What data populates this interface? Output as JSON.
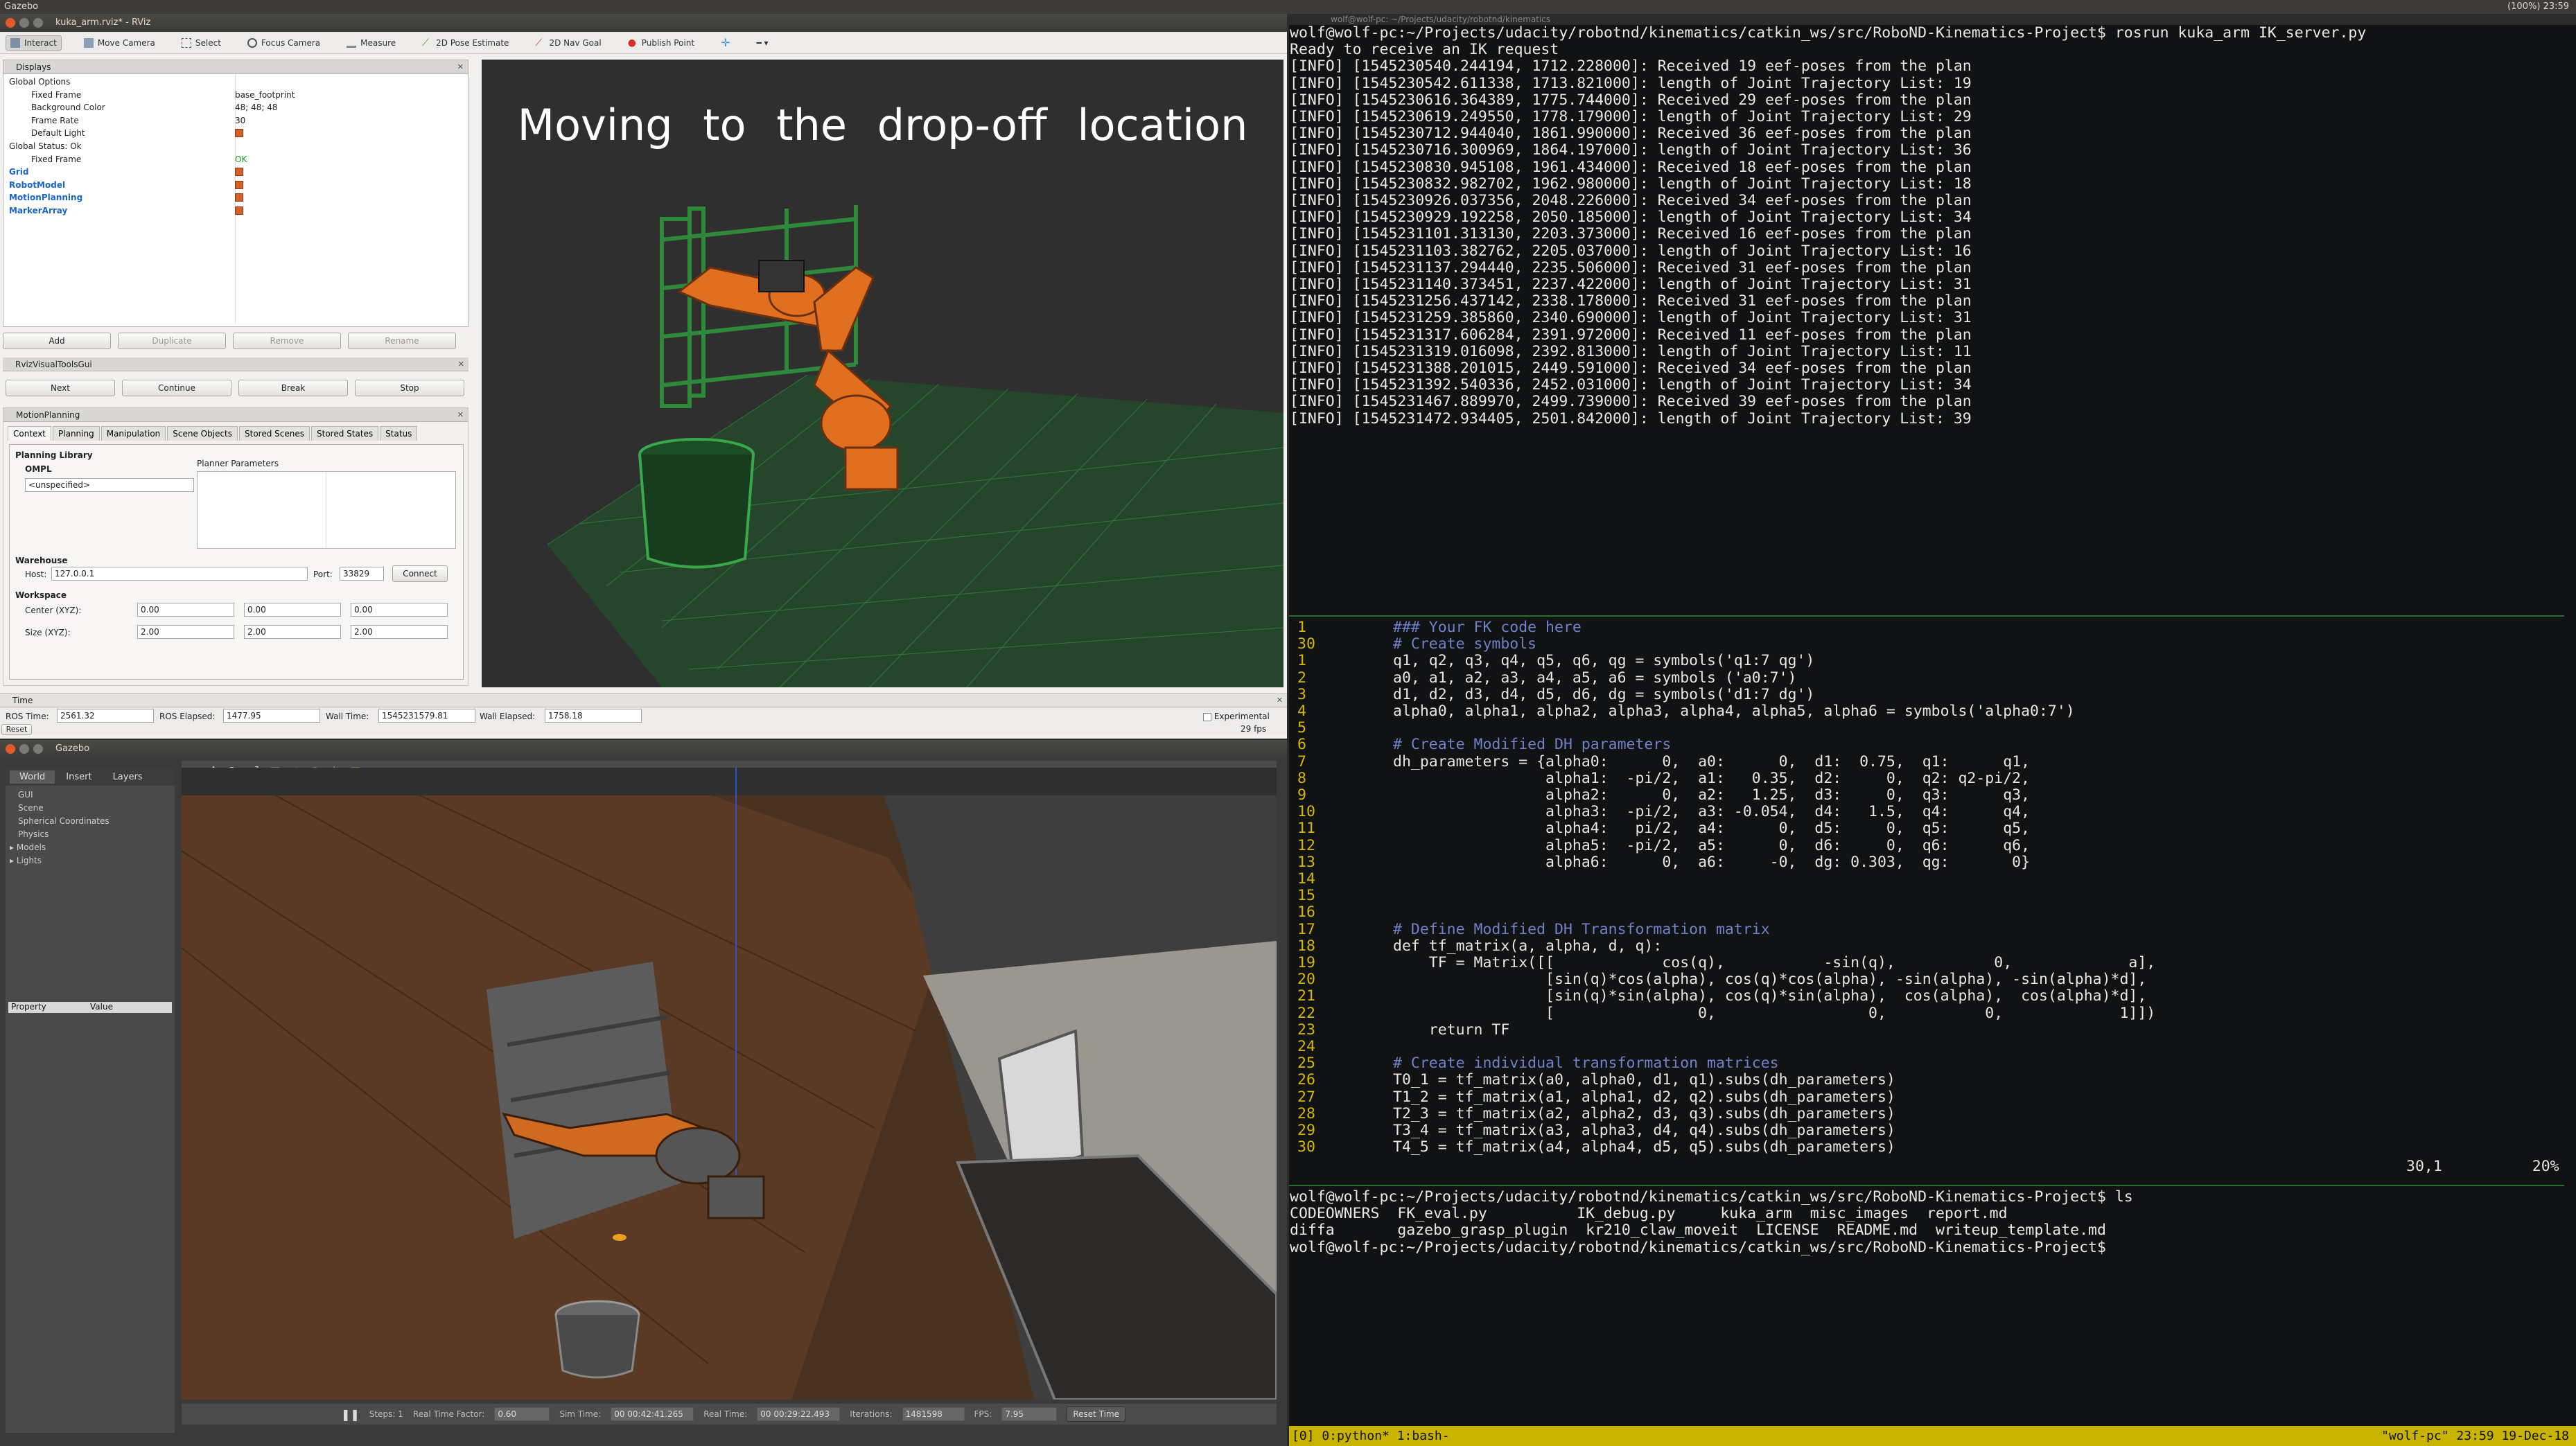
{
  "topbar": {
    "app": "Gazebo",
    "tray": "(100%)  23:59"
  },
  "rviz": {
    "title": "kuka_arm.rviz* - RViz",
    "toolbar": [
      "Interact",
      "Move Camera",
      "Select",
      "Focus Camera",
      "Measure",
      "2D Pose Estimate",
      "2D Nav Goal",
      "Publish Point"
    ],
    "displays": {
      "header": "Displays",
      "rows": [
        {
          "k": "Global Options",
          "v": "",
          "indent": 1
        },
        {
          "k": "Fixed Frame",
          "v": "base_footprint",
          "indent": 2
        },
        {
          "k": "Background Color",
          "v": "48; 48; 48",
          "indent": 2
        },
        {
          "k": "Frame Rate",
          "v": "30",
          "indent": 2
        },
        {
          "k": "Default Light",
          "v": "",
          "indent": 2
        },
        {
          "k": "Global Status: Ok",
          "v": "",
          "indent": 1
        },
        {
          "k": "Fixed Frame",
          "v": "OK",
          "indent": 2
        },
        {
          "k": "Grid",
          "v": "",
          "indent": 1
        },
        {
          "k": "RobotModel",
          "v": "",
          "indent": 1
        },
        {
          "k": "MotionPlanning",
          "v": "",
          "indent": 1
        },
        {
          "k": "MarkerArray",
          "v": "",
          "indent": 1
        }
      ],
      "buttons": [
        "Add",
        "Duplicate",
        "Remove",
        "Rename"
      ]
    },
    "visualtools": {
      "header": "RvizVisualToolsGui",
      "buttons": [
        "Next",
        "Continue",
        "Break",
        "Stop"
      ]
    },
    "motionplanning": {
      "header": "MotionPlanning",
      "tabs": [
        "Context",
        "Planning",
        "Manipulation",
        "Scene Objects",
        "Stored Scenes",
        "Stored States",
        "Status"
      ],
      "planning_library": "Planning Library",
      "ompl": "OMPL",
      "planner": "<unspecified>",
      "planner_params": "Planner Parameters",
      "warehouse": "Warehouse",
      "host_label": "Host:",
      "host": "127.0.0.1",
      "port_label": "Port:",
      "port": "33829",
      "connect": "Connect",
      "workspace": "Workspace",
      "center_label": "Center (XYZ):",
      "center": [
        "0.00",
        "0.00",
        "0.00"
      ],
      "size_label": "Size (XYZ):",
      "size": [
        "2.00",
        "2.00",
        "2.00"
      ]
    },
    "caption": "Moving to the drop-off location",
    "time": {
      "header": "Time",
      "ros_time_label": "ROS Time:",
      "ros_time": "2561.32",
      "ros_elapsed_label": "ROS Elapsed:",
      "ros_elapsed": "1477.95",
      "wall_time_label": "Wall Time:",
      "wall_time": "1545231579.81",
      "wall_elapsed_label": "Wall Elapsed:",
      "wall_elapsed": "1758.18",
      "experimental": "Experimental",
      "reset": "Reset",
      "fps": "29 fps"
    }
  },
  "gazebo": {
    "title": "Gazebo",
    "tabs": [
      "World",
      "Insert",
      "Layers"
    ],
    "tree": [
      "GUI",
      "Scene",
      "Spherical Coordinates",
      "Physics",
      "Models",
      "Lights"
    ],
    "prop_headers": [
      "Property",
      "Value"
    ],
    "bottom": {
      "steps": "Steps: 1",
      "rtf_label": "Real Time Factor:",
      "rtf": "0.60",
      "sim_label": "Sim Time:",
      "sim": "00 00:42:41.265",
      "real_label": "Real Time:",
      "real": "00 00:29:22.493",
      "iter_label": "Iterations:",
      "iter": "1481598",
      "fps_label": "FPS:",
      "fps": "7.95",
      "reset": "Reset Time"
    }
  },
  "terminal": {
    "title": "wolf@wolf-pc: ~/Projects/udacity/robotnd/kinematics",
    "top": [
      "wolf@wolf-pc:~/Projects/udacity/robotnd/kinematics/catkin_ws/src/RoboND-Kinematics-Project$ rosrun kuka_arm IK_server.py",
      "Ready to receive an IK request",
      "[INFO] [1545230540.244194, 1712.228000]: Received 19 eef-poses from the plan",
      "[INFO] [1545230542.611338, 1713.821000]: length of Joint Trajectory List: 19",
      "[INFO] [1545230616.364389, 1775.744000]: Received 29 eef-poses from the plan",
      "[INFO] [1545230619.249550, 1778.179000]: length of Joint Trajectory List: 29",
      "[INFO] [1545230712.944040, 1861.990000]: Received 36 eef-poses from the plan",
      "[INFO] [1545230716.300969, 1864.197000]: length of Joint Trajectory List: 36",
      "[INFO] [1545230830.945108, 1961.434000]: Received 18 eef-poses from the plan",
      "[INFO] [1545230832.982702, 1962.980000]: length of Joint Trajectory List: 18",
      "[INFO] [1545230926.037356, 2048.226000]: Received 34 eef-poses from the plan",
      "[INFO] [1545230929.192258, 2050.185000]: length of Joint Trajectory List: 34",
      "[INFO] [1545231101.313130, 2203.373000]: Received 16 eef-poses from the plan",
      "[INFO] [1545231103.382762, 2205.037000]: length of Joint Trajectory List: 16",
      "[INFO] [1545231137.294440, 2235.506000]: Received 31 eef-poses from the plan",
      "[INFO] [1545231140.373451, 2237.422000]: length of Joint Trajectory List: 31",
      "[INFO] [1545231256.437142, 2338.178000]: Received 31 eef-poses from the plan",
      "[INFO] [1545231259.385860, 2340.690000]: length of Joint Trajectory List: 31",
      "[INFO] [1545231317.606284, 2391.972000]: Received 11 eef-poses from the plan",
      "[INFO] [1545231319.016098, 2392.813000]: length of Joint Trajectory List: 11",
      "[INFO] [1545231388.201015, 2449.591000]: Received 34 eef-poses from the plan",
      "[INFO] [1545231392.540336, 2452.031000]: length of Joint Trajectory List: 34",
      "[INFO] [1545231467.889970, 2499.739000]: Received 39 eef-poses from the plan",
      "[INFO] [1545231472.934405, 2501.842000]: length of Joint Trajectory List: 39"
    ],
    "vim_status": {
      "pos": "30,1",
      "pct": "20%"
    },
    "bottom": [
      "wolf@wolf-pc:~/Projects/udacity/robotnd/kinematics/catkin_ws/src/RoboND-Kinematics-Project$ ls",
      "CODEOWNERS  FK_eval.py          IK_debug.py     kuka_arm  misc_images  report.md",
      "diffa       gazebo_grasp_plugin  kr210_claw_moveit  LICENSE  README.md  writeup_template.md",
      "wolf@wolf-pc:~/Projects/udacity/robotnd/kinematics/catkin_ws/src/RoboND-Kinematics-Project$"
    ],
    "tmux": "[0] 0:python* 1:bash-",
    "tmux_right": "\"wolf-pc\" 23:59 19-Dec-18"
  },
  "vim": [
    {
      "n": "1",
      "t": "### Your FK code here",
      "c": "cmt"
    },
    {
      "n": "30",
      "t": "# Create symbols",
      "c": "cmt"
    },
    {
      "n": "1",
      "t": "q1, q2, q3, q4, q5, q6, qg = symbols('q1:7 qg')",
      "c": "code"
    },
    {
      "n": "2",
      "t": "a0, a1, a2, a3, a4, a5, a6 = symbols ('a0:7')",
      "c": "code"
    },
    {
      "n": "3",
      "t": "d1, d2, d3, d4, d5, d6, dg = symbols('d1:7 dg')",
      "c": "code"
    },
    {
      "n": "4",
      "t": "alpha0, alpha1, alpha2, alpha3, alpha4, alpha5, alpha6 = symbols('alpha0:7')",
      "c": "code"
    },
    {
      "n": "5",
      "t": "",
      "c": "code"
    },
    {
      "n": "6",
      "t": "# Create Modified DH parameters",
      "c": "cmt"
    },
    {
      "n": "7",
      "t": "dh_parameters = {alpha0:      0,  a0:      0,  d1:  0.75,  q1:      q1,",
      "c": "code"
    },
    {
      "n": "8",
      "t": "                 alpha1:  -pi/2,  a1:   0.35,  d2:     0,  q2: q2-pi/2,",
      "c": "code"
    },
    {
      "n": "9",
      "t": "                 alpha2:      0,  a2:   1.25,  d3:     0,  q3:      q3,",
      "c": "code"
    },
    {
      "n": "10",
      "t": "                 alpha3:  -pi/2,  a3: -0.054,  d4:   1.5,  q4:      q4,",
      "c": "code"
    },
    {
      "n": "11",
      "t": "                 alpha4:   pi/2,  a4:      0,  d5:     0,  q5:      q5,",
      "c": "code"
    },
    {
      "n": "12",
      "t": "                 alpha5:  -pi/2,  a5:      0,  d6:     0,  q6:      q6,",
      "c": "code"
    },
    {
      "n": "13",
      "t": "                 alpha6:      0,  a6:     -0,  dg: 0.303,  qg:       0}",
      "c": "code"
    },
    {
      "n": "14",
      "t": "",
      "c": "code"
    },
    {
      "n": "15",
      "t": "",
      "c": "code"
    },
    {
      "n": "16",
      "t": "",
      "c": "code"
    },
    {
      "n": "17",
      "t": "# Define Modified DH Transformation matrix",
      "c": "cmt"
    },
    {
      "n": "18",
      "t": "def tf_matrix(a, alpha, d, q):",
      "c": "code"
    },
    {
      "n": "19",
      "t": "    TF = Matrix([[            cos(q),           -sin(q),           0,             a],",
      "c": "code"
    },
    {
      "n": "20",
      "t": "                 [sin(q)*cos(alpha), cos(q)*cos(alpha), -sin(alpha), -sin(alpha)*d],",
      "c": "code"
    },
    {
      "n": "21",
      "t": "                 [sin(q)*sin(alpha), cos(q)*sin(alpha),  cos(alpha),  cos(alpha)*d],",
      "c": "code"
    },
    {
      "n": "22",
      "t": "                 [                0,                 0,           0,             1]])",
      "c": "code"
    },
    {
      "n": "23",
      "t": "    return TF",
      "c": "code"
    },
    {
      "n": "24",
      "t": "",
      "c": "code"
    },
    {
      "n": "25",
      "t": "# Create individual transformation matrices",
      "c": "cmt"
    },
    {
      "n": "26",
      "t": "T0_1 = tf_matrix(a0, alpha0, d1, q1).subs(dh_parameters)",
      "c": "code"
    },
    {
      "n": "27",
      "t": "T1_2 = tf_matrix(a1, alpha1, d2, q2).subs(dh_parameters)",
      "c": "code"
    },
    {
      "n": "28",
      "t": "T2_3 = tf_matrix(a2, alpha2, d3, q3).subs(dh_parameters)",
      "c": "code"
    },
    {
      "n": "29",
      "t": "T3_4 = tf_matrix(a3, alpha3, d4, q4).subs(dh_parameters)",
      "c": "code"
    },
    {
      "n": "30",
      "t": "T4_5 = tf_matrix(a4, alpha4, d5, q5).subs(dh_parameters)",
      "c": "code"
    }
  ]
}
